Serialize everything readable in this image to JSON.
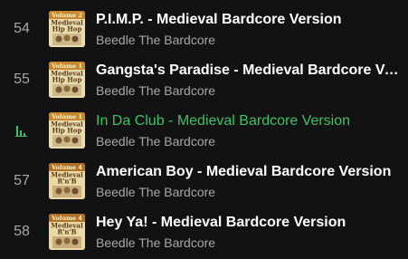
{
  "colors": {
    "background": "#121212",
    "title": "#ffffff",
    "playing_accent": "#3fc266",
    "secondary_text": "#a7a7a7"
  },
  "tracks": [
    {
      "number": "54",
      "title": "P.I.M.P. - Medieval Bardcore Version",
      "artist": "Beedle The Bardcore",
      "cover": {
        "line1": "Volume 2",
        "line2": "Medieval",
        "line3": "Hip Hop"
      },
      "playing": false
    },
    {
      "number": "55",
      "title": "Gangsta's Paradise - Medieval Bardcore Version",
      "artist": "Beedle The Bardcore",
      "cover": {
        "line1": "Volume 1",
        "line2": "Medieval",
        "line3": "Hip Hop"
      },
      "playing": false
    },
    {
      "number": "",
      "title": "In Da Club - Medieval Bardcore Version",
      "artist": "Beedle The Bardcore",
      "cover": {
        "line1": "Volume 1",
        "line2": "Medieval",
        "line3": "Hip Hop"
      },
      "playing": true,
      "indicator_icon": "equalizer-icon"
    },
    {
      "number": "57",
      "title": "American Boy - Medieval Bardcore Version",
      "artist": "Beedle The Bardcore",
      "cover": {
        "line1": "Volume 4",
        "line2": "Medieval",
        "line3": "R'n'B"
      },
      "playing": false
    },
    {
      "number": "58",
      "title": "Hey Ya! - Medieval Bardcore Version",
      "artist": "Beedle The Bardcore",
      "cover": {
        "line1": "Volume 4",
        "line2": "Medieval",
        "line3": "R'n'B"
      },
      "playing": false
    }
  ]
}
